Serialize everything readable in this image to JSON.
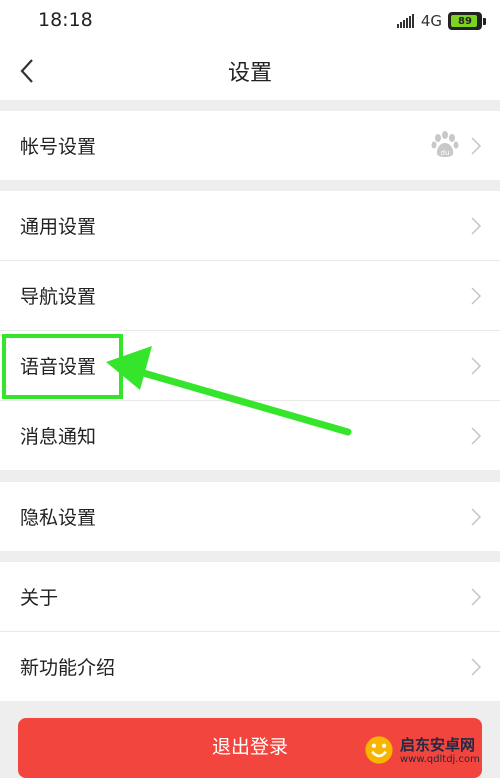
{
  "status_bar": {
    "time": "18:18",
    "network": "4G",
    "battery": "89"
  },
  "header": {
    "title": "设置"
  },
  "groups": [
    {
      "items": [
        {
          "label": "帐号设置"
        }
      ]
    },
    {
      "items": [
        {
          "label": "通用设置"
        },
        {
          "label": "导航设置"
        },
        {
          "label": "语音设置"
        },
        {
          "label": "消息通知"
        }
      ]
    },
    {
      "items": [
        {
          "label": "隐私设置"
        }
      ]
    },
    {
      "items": [
        {
          "label": "关于"
        },
        {
          "label": "新功能介绍"
        }
      ]
    }
  ],
  "logout_label": "退出登录",
  "watermark": {
    "name": "启东安卓网",
    "url": "www.qdltdj.com"
  },
  "colors": {
    "highlight": "#34e52b",
    "logout": "#f2453d",
    "battery": "#7ed321"
  }
}
